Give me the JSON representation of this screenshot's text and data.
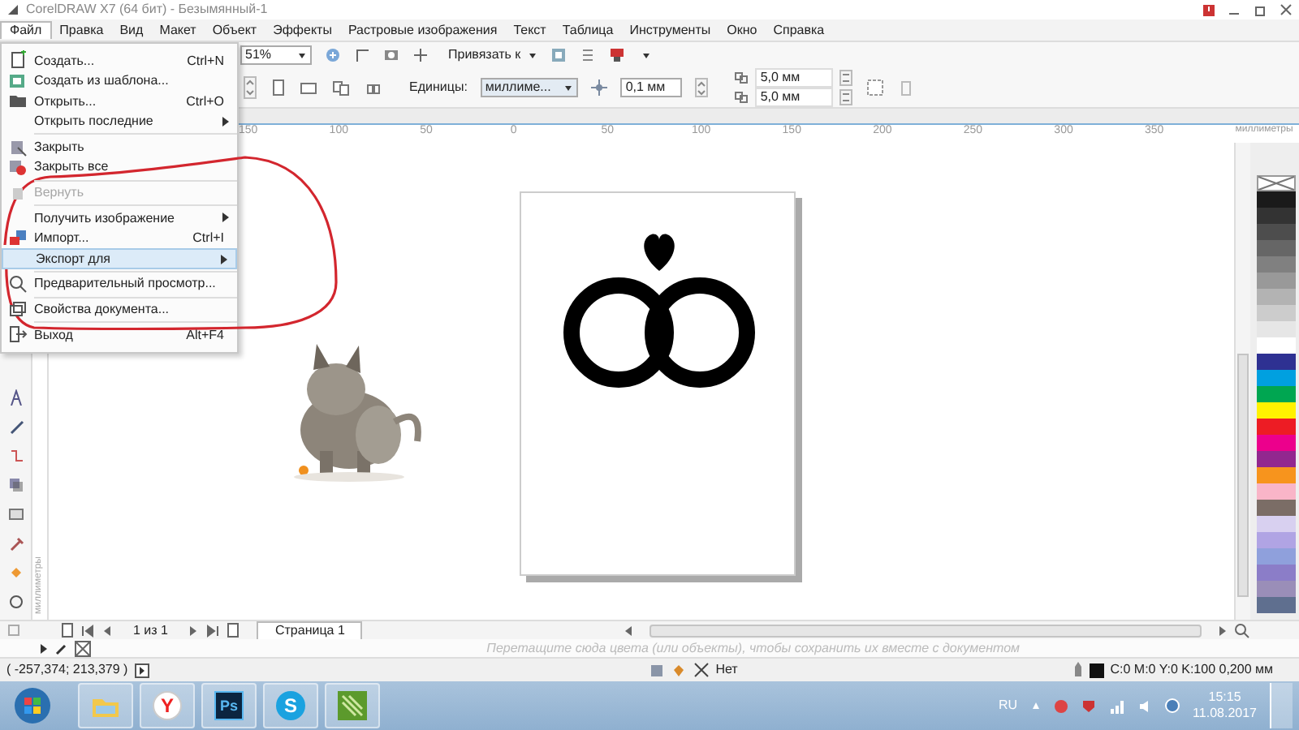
{
  "window": {
    "title": "CorelDRAW X7 (64 бит) - Безымянный-1"
  },
  "menu_bar": [
    {
      "label": "Файл",
      "selected": true
    },
    {
      "label": "Правка",
      "selected": false
    },
    {
      "label": "Вид",
      "selected": false
    },
    {
      "label": "Макет",
      "selected": false
    },
    {
      "label": "Объект",
      "selected": false
    },
    {
      "label": "Эффекты",
      "selected": false
    },
    {
      "label": "Растровые изображения",
      "selected": false
    },
    {
      "label": "Текст",
      "selected": false
    },
    {
      "label": "Таблица",
      "selected": false
    },
    {
      "label": "Инструменты",
      "selected": false
    },
    {
      "label": "Окно",
      "selected": false
    },
    {
      "label": "Справка",
      "selected": false
    }
  ],
  "file_menu": {
    "items": [
      {
        "kind": "item",
        "label": "Создать...",
        "shortcut": "Ctrl+N",
        "submenu": false,
        "disabled": false,
        "selected": false
      },
      {
        "kind": "item",
        "label": "Создать из шаблона...",
        "submenu": false,
        "disabled": false,
        "selected": false
      },
      {
        "kind": "item",
        "label": "Открыть...",
        "shortcut": "Ctrl+O",
        "submenu": false,
        "disabled": false,
        "selected": false
      },
      {
        "kind": "item",
        "label": "Открыть последние",
        "submenu": true,
        "disabled": false,
        "selected": false
      },
      {
        "kind": "separator"
      },
      {
        "kind": "item",
        "label": "Закрыть",
        "submenu": false,
        "disabled": false,
        "selected": false
      },
      {
        "kind": "item",
        "label": "Закрыть все",
        "submenu": false,
        "disabled": false,
        "selected": false
      },
      {
        "kind": "separator"
      },
      {
        "kind": "item",
        "label": "Вернуть",
        "submenu": false,
        "disabled": true,
        "selected": false
      },
      {
        "kind": "separator"
      },
      {
        "kind": "item",
        "label": "Получить изображение",
        "submenu": true,
        "disabled": false,
        "selected": false
      },
      {
        "kind": "item",
        "label": "Импорт...",
        "shortcut": "Ctrl+I",
        "submenu": false,
        "disabled": false,
        "selected": false
      },
      {
        "kind": "item",
        "label": "Экспорт для",
        "submenu": true,
        "disabled": false,
        "selected": true
      },
      {
        "kind": "separator"
      },
      {
        "kind": "item",
        "label": "Предварительный просмотр...",
        "submenu": false,
        "disabled": false,
        "selected": false
      },
      {
        "kind": "separator"
      },
      {
        "kind": "item",
        "label": "Свойства документа...",
        "submenu": false,
        "disabled": false,
        "selected": false
      },
      {
        "kind": "separator"
      },
      {
        "kind": "item",
        "label": "Выход",
        "shortcut": "Alt+F4",
        "submenu": false,
        "disabled": false,
        "selected": false
      }
    ]
  },
  "toolbar": {
    "zoom": "51%",
    "snap": "Привязать к"
  },
  "property_bar": {
    "units_label": "Единицы:",
    "units": "миллиме...",
    "nudge": "0,1 мм",
    "duplicate_x": "5,0 мм",
    "duplicate_y": "5,0 мм"
  },
  "ruler": {
    "labels": [
      "150",
      "100",
      "50",
      "0",
      "50",
      "100",
      "150",
      "200",
      "250",
      "300",
      "350"
    ],
    "unit": "миллиметры"
  },
  "vertical_ruler": {
    "unit": "миллиметры"
  },
  "page_nav": {
    "count": "1 из 1",
    "tabs": [
      {
        "label": "Страница 1",
        "selected": true
      }
    ]
  },
  "palette": {
    "swatches": [
      {
        "color": "#1a1a1a"
      },
      {
        "color": "#333333"
      },
      {
        "color": "#4d4d4d"
      },
      {
        "color": "#666666"
      },
      {
        "color": "#808080"
      },
      {
        "color": "#999999"
      },
      {
        "color": "#b3b3b3"
      },
      {
        "color": "#cccccc"
      },
      {
        "color": "#e6e6e6"
      },
      {
        "color": "#ffffff"
      },
      {
        "color": "#2e3192"
      },
      {
        "color": "#00a0e0"
      },
      {
        "color": "#00a651"
      },
      {
        "color": "#fff200"
      },
      {
        "color": "#ed1c24"
      },
      {
        "color": "#ec008c"
      },
      {
        "color": "#92278f"
      },
      {
        "color": "#f7941d"
      },
      {
        "color": "#f9b5c8"
      },
      {
        "color": "#7b6d66"
      },
      {
        "color": "#d8d0f0"
      },
      {
        "color": "#b0a4e4"
      },
      {
        "color": "#8fa0dc"
      },
      {
        "color": "#8b7dc8"
      },
      {
        "color": "#9a8eb8"
      },
      {
        "color": "#5f6f8f"
      }
    ]
  },
  "drop_hint": "Перетащите сюда цвета (или объекты), чтобы сохранить их вместе с документом",
  "status_bar": {
    "coordinates": "( -257,374; 213,379 )",
    "fill": "Нет",
    "outline": "C:0 M:0 Y:0 K:100  0,200 мм"
  },
  "taskbar": {
    "apps": [
      {
        "kind": "explorer"
      },
      {
        "kind": "yandex",
        "label": "Y"
      },
      {
        "kind": "photoshop",
        "label": "Ps"
      },
      {
        "kind": "skype",
        "label": "S"
      },
      {
        "kind": "corel"
      }
    ],
    "language": "RU",
    "time": "15:15",
    "date": "11.08.2017"
  }
}
